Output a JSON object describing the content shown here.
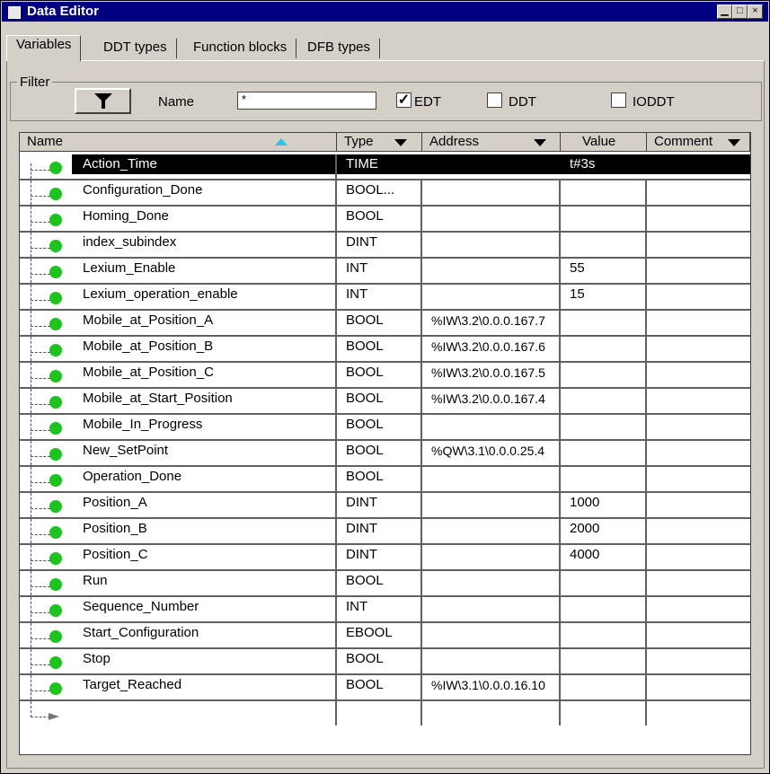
{
  "window": {
    "title": "Data Editor"
  },
  "tabs": [
    {
      "label": "Variables"
    },
    {
      "label": "DDT types"
    },
    {
      "label": "Function blocks"
    },
    {
      "label": "DFB types"
    }
  ],
  "filter": {
    "legend": "Filter",
    "name_label": "Name",
    "name_value": "*",
    "checkboxes": [
      {
        "label": "EDT",
        "checked": true
      },
      {
        "label": "DDT",
        "checked": false
      },
      {
        "label": "IODDT",
        "checked": false
      }
    ]
  },
  "columns": [
    "Name",
    "Type",
    "Address",
    "Value",
    "Comment"
  ],
  "rows": [
    {
      "name": "Action_Time",
      "type": "TIME",
      "address": "",
      "value": "t#3s",
      "selected": true
    },
    {
      "name": "Configuration_Done",
      "type": "BOOL...",
      "address": "",
      "value": ""
    },
    {
      "name": "Homing_Done",
      "type": "BOOL",
      "address": "",
      "value": ""
    },
    {
      "name": "index_subindex",
      "type": "DINT",
      "address": "",
      "value": ""
    },
    {
      "name": "Lexium_Enable",
      "type": "INT",
      "address": "",
      "value": "55"
    },
    {
      "name": "Lexium_operation_enable",
      "type": "INT",
      "address": "",
      "value": "15"
    },
    {
      "name": "Mobile_at_Position_A",
      "type": "BOOL",
      "address": "%IW\\3.2\\0.0.0.167.7",
      "value": ""
    },
    {
      "name": "Mobile_at_Position_B",
      "type": "BOOL",
      "address": "%IW\\3.2\\0.0.0.167.6",
      "value": ""
    },
    {
      "name": "Mobile_at_Position_C",
      "type": "BOOL",
      "address": "%IW\\3.2\\0.0.0.167.5",
      "value": ""
    },
    {
      "name": "Mobile_at_Start_Position",
      "type": "BOOL",
      "address": "%IW\\3.2\\0.0.0.167.4",
      "value": ""
    },
    {
      "name": "Mobile_In_Progress",
      "type": "BOOL",
      "address": "",
      "value": ""
    },
    {
      "name": "New_SetPoint",
      "type": "BOOL",
      "address": "%QW\\3.1\\0.0.0.25.4",
      "value": ""
    },
    {
      "name": "Operation_Done",
      "type": "BOOL",
      "address": "",
      "value": ""
    },
    {
      "name": "Position_A",
      "type": "DINT",
      "address": "",
      "value": "1000"
    },
    {
      "name": "Position_B",
      "type": "DINT",
      "address": "",
      "value": "2000"
    },
    {
      "name": "Position_C",
      "type": "DINT",
      "address": "",
      "value": "4000"
    },
    {
      "name": "Run",
      "type": "BOOL",
      "address": "",
      "value": ""
    },
    {
      "name": "Sequence_Number",
      "type": "INT",
      "address": "",
      "value": ""
    },
    {
      "name": "Start_Configuration",
      "type": "EBOOL",
      "address": "",
      "value": ""
    },
    {
      "name": "Stop",
      "type": "BOOL",
      "address": "",
      "value": ""
    },
    {
      "name": "Target_Reached",
      "type": "BOOL",
      "address": "%IW\\3.1\\0.0.0.16.10",
      "value": ""
    }
  ]
}
